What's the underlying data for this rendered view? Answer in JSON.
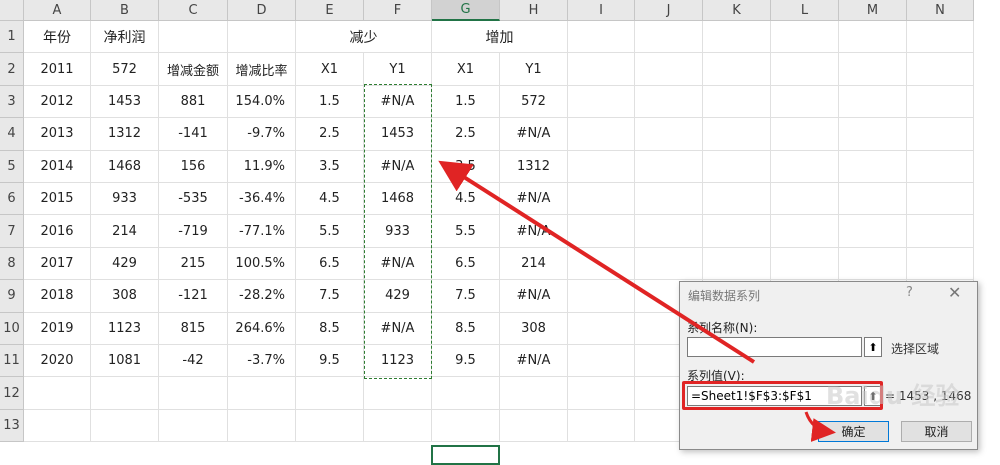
{
  "columns": [
    "A",
    "B",
    "C",
    "D",
    "E",
    "F",
    "G",
    "H",
    "I",
    "J",
    "K",
    "L",
    "M",
    "N"
  ],
  "rows": [
    "1",
    "2",
    "3",
    "4",
    "5",
    "6",
    "7",
    "8",
    "9",
    "10",
    "11",
    "12",
    "13"
  ],
  "selected_column": "G",
  "header_row": {
    "A": "年份",
    "B": "净利润",
    "E": "减少",
    "G": "增加"
  },
  "subheader_row": {
    "A": "2011",
    "B": "572",
    "C": "增减金额",
    "D": "增减比率",
    "E": "X1",
    "F": "Y1",
    "G": "X1",
    "H": "Y1"
  },
  "table_rows": [
    [
      "2012",
      "1453",
      "881",
      "154.0%",
      "1.5",
      "#N/A",
      "1.5",
      "572"
    ],
    [
      "2013",
      "1312",
      "-141",
      "-9.7%",
      "2.5",
      "1453",
      "2.5",
      "#N/A"
    ],
    [
      "2014",
      "1468",
      "156",
      "11.9%",
      "3.5",
      "#N/A",
      "3.5",
      "1312"
    ],
    [
      "2015",
      "933",
      "-535",
      "-36.4%",
      "4.5",
      "1468",
      "4.5",
      "#N/A"
    ],
    [
      "2016",
      "214",
      "-719",
      "-77.1%",
      "5.5",
      "933",
      "5.5",
      "#N/A"
    ],
    [
      "2017",
      "429",
      "215",
      "100.5%",
      "6.5",
      "#N/A",
      "6.5",
      "214"
    ],
    [
      "2018",
      "308",
      "-121",
      "-28.2%",
      "7.5",
      "429",
      "7.5",
      "#N/A"
    ],
    [
      "2019",
      "1123",
      "815",
      "264.6%",
      "8.5",
      "#N/A",
      "8.5",
      "308"
    ],
    [
      "2020",
      "1081",
      "-42",
      "-3.7%",
      "9.5",
      "1123",
      "9.5",
      "#N/A"
    ]
  ],
  "dialog": {
    "title": "编辑数据系列",
    "help": "?",
    "close": "✕",
    "series_name_label": "系列名称(N):",
    "series_name_value": "",
    "select_range": "选择区域",
    "series_values_label": "系列值(V):",
    "series_values_value": "=Sheet1!$F$3:$F$1",
    "series_values_preview": "= 1453 , 1468",
    "ok": "确定",
    "cancel": "取消",
    "collapse_icon": "upload-arrow-icon"
  },
  "colors": {
    "accent": "#217346",
    "annotation": "#e02424",
    "marquee": "#2e7d32"
  },
  "watermark": "Baidu 经验"
}
